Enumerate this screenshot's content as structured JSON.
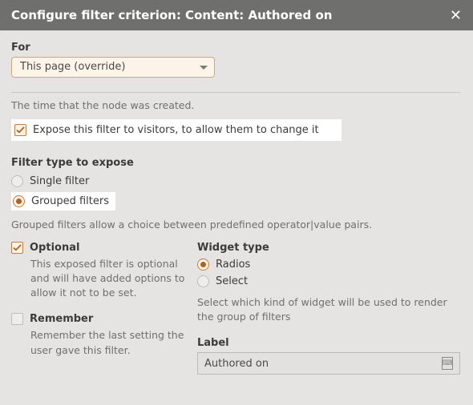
{
  "titlebar": {
    "title": "Configure filter criterion: Content: Authored on"
  },
  "for": {
    "label": "For",
    "value": "This page (override)"
  },
  "description": "The time that the node was created.",
  "expose": {
    "label": "Expose this filter to visitors, to allow them to change it",
    "checked": true
  },
  "filter_type": {
    "heading": "Filter type to expose",
    "options": {
      "single": "Single filter",
      "grouped": "Grouped filters"
    },
    "selected": "grouped",
    "help": "Grouped filters allow a choice between predefined operator|value pairs."
  },
  "optional": {
    "label": "Optional",
    "checked": true,
    "help": "This exposed filter is optional and will have added options to allow it not to be set."
  },
  "remember": {
    "label": "Remember",
    "checked": false,
    "help": "Remember the last setting the user gave this filter."
  },
  "widget": {
    "heading": "Widget type",
    "options": {
      "radios": "Radios",
      "select": "Select"
    },
    "selected": "radios",
    "help": "Select which kind of widget will be used to render the group of filters"
  },
  "label_field": {
    "label": "Label",
    "value": "Authored on"
  }
}
